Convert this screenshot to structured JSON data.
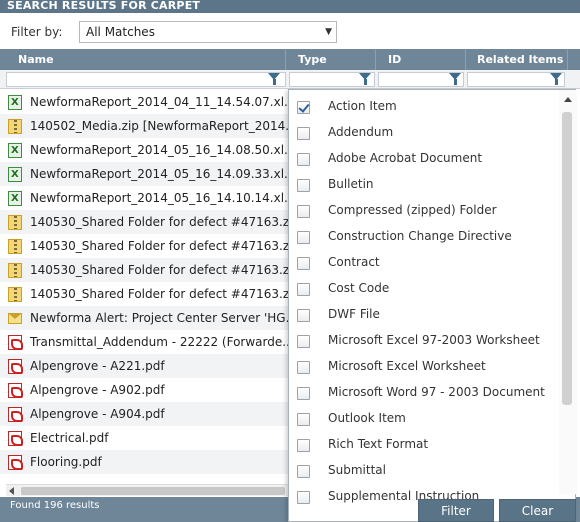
{
  "header": {
    "title": "SEARCH RESULTS FOR CARPET"
  },
  "filter": {
    "label": "Filter by:",
    "value": "All Matches"
  },
  "columns": {
    "name": "Name",
    "type": "Type",
    "id": "ID",
    "related": "Related Items"
  },
  "rows": [
    {
      "icon": "excel-icon",
      "name": "NewformaReport_2014_04_11_14.54.07.xl..."
    },
    {
      "icon": "zip-folder-icon",
      "name": "140502_Media.zip [NewformaReport_2014..."
    },
    {
      "icon": "excel-icon",
      "name": "NewformaReport_2014_05_16_14.08.50.xl..."
    },
    {
      "icon": "excel-icon",
      "name": "NewformaReport_2014_05_16_14.09.33.xl..."
    },
    {
      "icon": "excel-icon",
      "name": "NewformaReport_2014_05_16_14.10.14.xl..."
    },
    {
      "icon": "zip-folder-icon",
      "name": "140530_Shared Folder for defect #47163.z..."
    },
    {
      "icon": "zip-folder-icon",
      "name": "140530_Shared Folder for defect #47163.z..."
    },
    {
      "icon": "zip-folder-icon",
      "name": "140530_Shared Folder for defect #47163.z..."
    },
    {
      "icon": "zip-folder-icon",
      "name": "140530_Shared Folder for defect #47163.z..."
    },
    {
      "icon": "email-icon",
      "name": "Newforma Alert: Project Center Server 'HG..."
    },
    {
      "icon": "pdf-icon",
      "name": "Transmittal_Addendum - 22222 (Forwarde..."
    },
    {
      "icon": "pdf-icon",
      "name": "Alpengrove - A221.pdf"
    },
    {
      "icon": "pdf-icon",
      "name": "Alpengrove - A902.pdf"
    },
    {
      "icon": "pdf-icon",
      "name": "Alpengrove - A904.pdf"
    },
    {
      "icon": "pdf-icon",
      "name": "Electrical.pdf"
    },
    {
      "icon": "pdf-icon",
      "name": "Flooring.pdf"
    }
  ],
  "type_filter": {
    "options": [
      {
        "label": "Action Item",
        "checked": true
      },
      {
        "label": "Addendum",
        "checked": false
      },
      {
        "label": "Adobe Acrobat Document",
        "checked": false
      },
      {
        "label": "Bulletin",
        "checked": false
      },
      {
        "label": "Compressed (zipped) Folder",
        "checked": false
      },
      {
        "label": "Construction Change Directive",
        "checked": false
      },
      {
        "label": "Contract",
        "checked": false
      },
      {
        "label": "Cost Code",
        "checked": false
      },
      {
        "label": "DWF File",
        "checked": false
      },
      {
        "label": "Microsoft Excel 97-2003 Worksheet",
        "checked": false
      },
      {
        "label": "Microsoft Excel Worksheet",
        "checked": false
      },
      {
        "label": "Microsoft Word 97 - 2003 Document",
        "checked": false
      },
      {
        "label": "Outlook Item",
        "checked": false
      },
      {
        "label": "Rich Text Format",
        "checked": false
      },
      {
        "label": "Submittal",
        "checked": false
      },
      {
        "label": "Supplemental Instruction",
        "checked": false
      }
    ],
    "filter_button": "Filter",
    "clear_button": "Clear"
  },
  "status": {
    "text": "Found 196 results"
  },
  "colors": {
    "header": "#5d7589",
    "column_header": "#6f8699",
    "button": "#5a7487"
  }
}
